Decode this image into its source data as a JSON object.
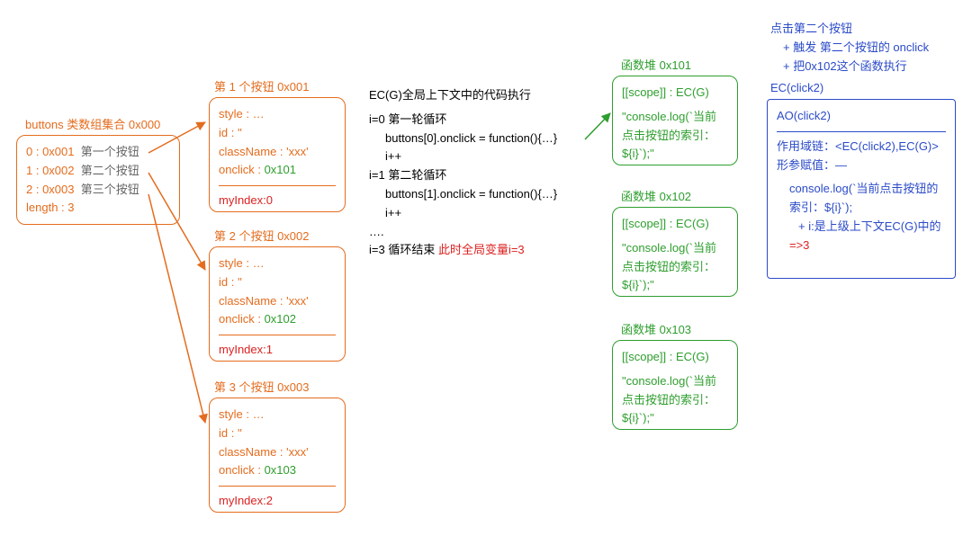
{
  "buttonsCollection": {
    "title": "buttons 类数组集合 0x000",
    "items": [
      {
        "idx": "0",
        "addr": "0x001",
        "label": "第一个按钮"
      },
      {
        "idx": "1",
        "addr": "0x002",
        "label": "第二个按钮"
      },
      {
        "idx": "2",
        "addr": "0x003",
        "label": "第三个按钮"
      }
    ],
    "length": "length : 3"
  },
  "buttons": [
    {
      "title": "第 1 个按钮 0x001",
      "style": "style : …",
      "id": "id : ''",
      "class": "className : 'xxx'",
      "onclickLabel": "onclick : ",
      "onclickAddr": "0x101",
      "myIndex": "myIndex:0"
    },
    {
      "title": "第 2 个按钮 0x002",
      "style": "style : …",
      "id": "id : ''",
      "class": "className : 'xxx'",
      "onclickLabel": "onclick : ",
      "onclickAddr": "0x102",
      "myIndex": "myIndex:1"
    },
    {
      "title": "第 3 个按钮 0x003",
      "style": "style : …",
      "id": "id : ''",
      "class": "className : 'xxx'",
      "onclickLabel": "onclick : ",
      "onclickAddr": "0x103",
      "myIndex": "myIndex:2"
    }
  ],
  "ecg": {
    "heading": "EC(G)全局上下文中的代码执行",
    "loop0_label": "i=0  第一轮循环",
    "loop0_body": "buttons[0].onclick = function(){…}",
    "loop0_inc": "i++",
    "loop1_label": "i=1 第二轮循环",
    "loop1_body": "buttons[1].onclick = function(){…}",
    "loop1_inc": "i++",
    "dots": "….",
    "loop_end_prefix": "i=3  循环结束  ",
    "loop_end_red": "此时全局变量i=3"
  },
  "heaps": [
    {
      "title": "函数堆 0x101",
      "scope": "[[scope]] : EC(G)",
      "body": "\"console.log(`当前点击按钮的索引：${i}`);\""
    },
    {
      "title": "函数堆 0x102",
      "scope": "[[scope]] : EC(G)",
      "body": "\"console.log(`当前点击按钮的索引：${i}`);\""
    },
    {
      "title": "函数堆 0x103",
      "scope": "[[scope]] : EC(G)",
      "body": "\"console.log(`当前点击按钮的索引：${i}`);\""
    }
  ],
  "clickNotes": {
    "l1": "点击第二个按钮",
    "l2": "+ 触发 第二个按钮的 onclick",
    "l3": "+ 把0x102这个函数执行"
  },
  "ec_click": {
    "title": "EC(click2)",
    "ao": "AO(click2)",
    "scopeChain": "作用域链：<EC(click2),EC(G)>",
    "args": "形参赋值：—",
    "code1": "console.log(`当前点击按钮的索引：${i}`);",
    "code2_prefix": "+ i:是上级上下文EC(G)中的",
    "result": "=>3"
  }
}
